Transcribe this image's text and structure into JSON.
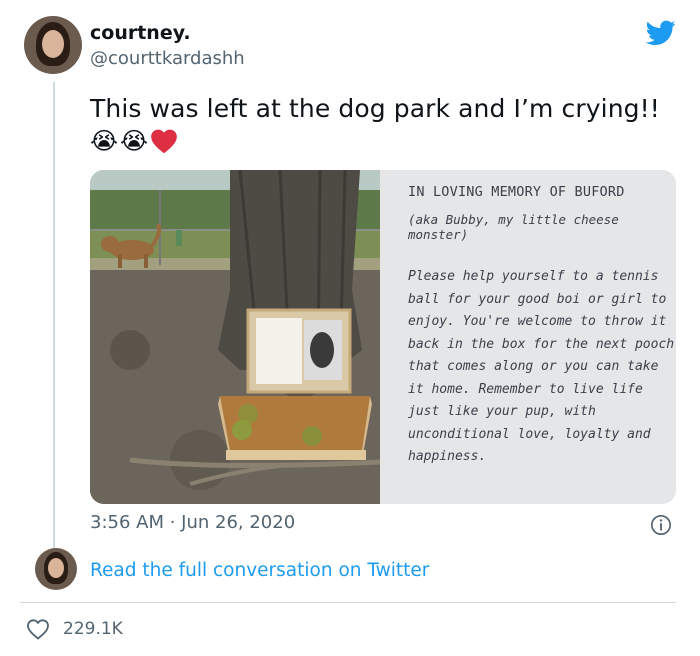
{
  "tweet": {
    "author_name": "courtney.",
    "author_handle": "@courttkardashh",
    "text": "This was left at the dog park and I’m crying!!",
    "emojis": [
      "😭",
      "😭"
    ],
    "timestamp": "3:56 AM · Jun 26, 2020",
    "like_count": "229.1K",
    "conversation_link": "Read the full conversation on Twitter"
  },
  "note": {
    "heading": "IN LOVING MEMORY OF BUFORD",
    "subheading": "(aka Bubby, my little cheese monster)",
    "body": "Please help yourself to a tennis ball for your good boi or girl to enjoy. You're welcome to throw it back in the box for the next pooch that comes along or you can take it home. Remember to live life just like your pup, with unconditional love, loyalty and happiness."
  },
  "colors": {
    "brand": "#1d9bf0",
    "heart": "#e0245e",
    "text": "#0f1419",
    "muted": "#536471"
  },
  "icons": [
    "twitter-bird-icon",
    "info-icon",
    "heart-icon"
  ]
}
